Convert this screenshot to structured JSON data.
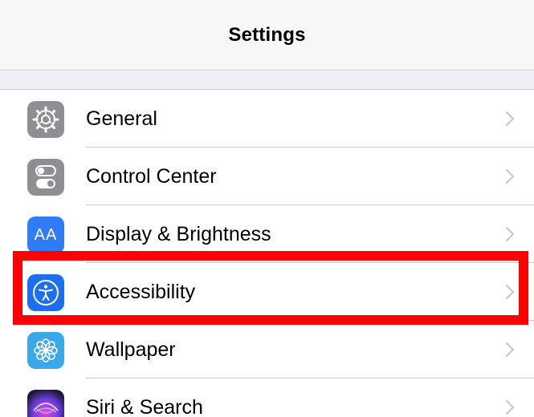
{
  "nav": {
    "title": "Settings"
  },
  "settings": {
    "items": [
      {
        "label": "General",
        "icon": "gear-icon",
        "icon_color": "#8e8e93"
      },
      {
        "label": "Control Center",
        "icon": "toggle-switches-icon",
        "icon_color": "#8e8e93"
      },
      {
        "label": "Display & Brightness",
        "icon": "text-size-icon",
        "icon_text": "AA",
        "icon_color": "#2f7cf6"
      },
      {
        "label": "Accessibility",
        "icon": "accessibility-person-icon",
        "icon_color": "#1d6ff0",
        "highlighted": true
      },
      {
        "label": "Wallpaper",
        "icon": "flower-icon",
        "icon_color": "#3aa7e8"
      },
      {
        "label": "Siri & Search",
        "icon": "siri-icon",
        "icon_color": "#6e3be0"
      }
    ]
  },
  "highlight": {
    "color": "#ff0000"
  }
}
